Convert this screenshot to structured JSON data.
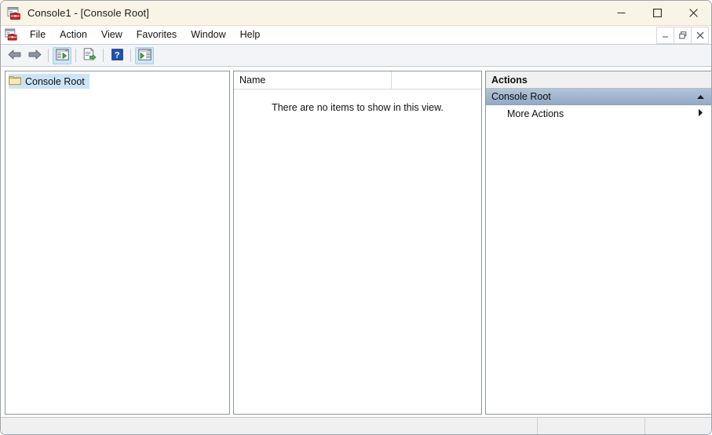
{
  "window": {
    "title": "Console1 - [Console Root]",
    "app_icon": "mmc-console-icon",
    "controls": {
      "minimize": "minimize-button",
      "maximize": "maximize-button",
      "close": "close-button"
    }
  },
  "menubar": {
    "child_icon": "mmc-child-window-icon",
    "items": [
      {
        "label": "File"
      },
      {
        "label": "Action"
      },
      {
        "label": "View"
      },
      {
        "label": "Favorites"
      },
      {
        "label": "Window"
      },
      {
        "label": "Help"
      }
    ],
    "mdi_controls": {
      "minimize": "mdi-minimize-button",
      "restore": "mdi-restore-button",
      "close": "mdi-close-button"
    }
  },
  "toolbar": {
    "buttons": [
      {
        "name": "back-button",
        "icon": "back-arrow-icon",
        "pressed": false
      },
      {
        "name": "forward-button",
        "icon": "forward-arrow-icon",
        "pressed": false
      },
      {
        "name": "show-hide-console-tree-button",
        "icon": "console-tree-icon",
        "pressed": true
      },
      {
        "name": "export-list-button",
        "icon": "export-list-icon",
        "pressed": false
      },
      {
        "name": "help-button",
        "icon": "help-question-icon",
        "pressed": false
      },
      {
        "name": "show-hide-action-pane-button",
        "icon": "action-pane-icon",
        "pressed": true
      }
    ]
  },
  "tree": {
    "items": [
      {
        "label": "Console Root",
        "icon": "folder-icon",
        "selected": true
      }
    ]
  },
  "list": {
    "columns": [
      {
        "label": "Name"
      }
    ],
    "empty_message": "There are no items to show in this view."
  },
  "actions": {
    "title": "Actions",
    "groups": [
      {
        "label": "Console Root",
        "collapse_icon": "chevron-up-icon",
        "rows": [
          {
            "label": "More Actions",
            "submenu_icon": "submenu-arrow-icon"
          }
        ]
      }
    ]
  },
  "statusbar": {
    "cells": [
      "",
      "",
      ""
    ]
  },
  "colors": {
    "titlebar_bg": "#faf4e6",
    "selection_blue": "#cce4f7",
    "action_group_blue": "#a2b6cf",
    "pane_border": "#8f959e",
    "statusbar_bg": "#f0f0f0"
  }
}
